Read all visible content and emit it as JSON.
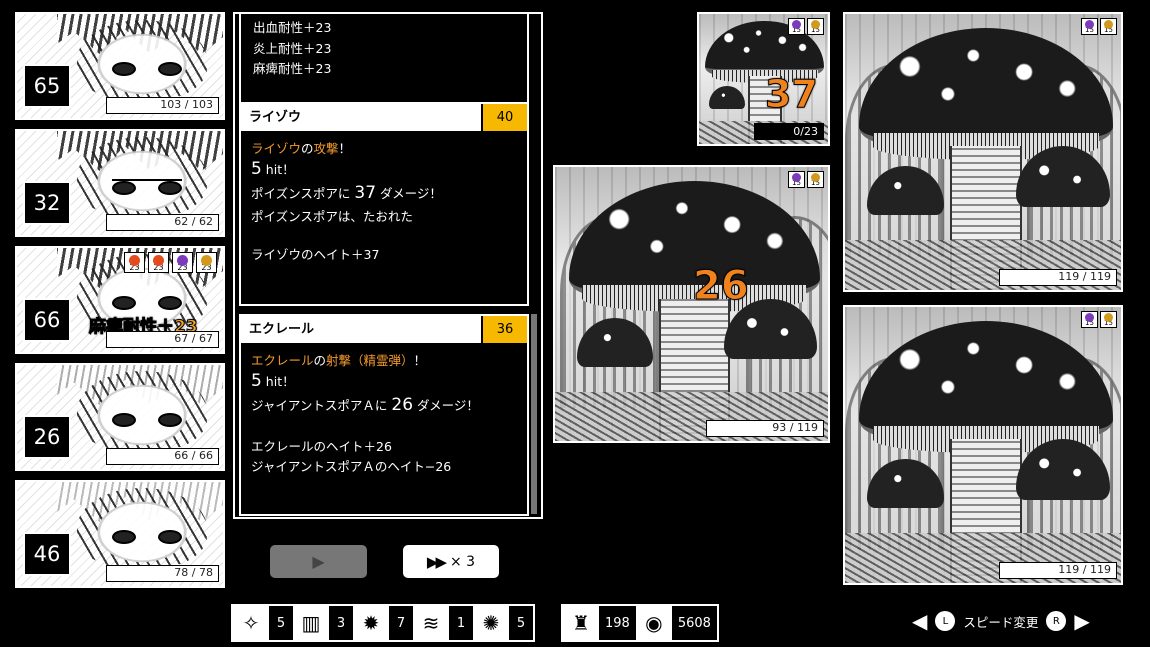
{
  "party": [
    {
      "level": "65",
      "hp": "103 / 103",
      "status": []
    },
    {
      "level": "32",
      "hp": "62 / 62",
      "status": []
    },
    {
      "level": "66",
      "hp": "67 / 67",
      "float": "麻痺耐性＋23",
      "status": [
        {
          "icon": "fire-icon",
          "value": "23",
          "color": "#e34b1f"
        },
        {
          "icon": "flame-icon",
          "value": "23",
          "color": "#e34b1f"
        },
        {
          "icon": "poison-icon",
          "value": "23",
          "color": "#7c3bbd"
        },
        {
          "icon": "shield-icon",
          "value": "23",
          "color": "#d29a1c"
        }
      ]
    },
    {
      "level": "26",
      "hp": "66 / 66",
      "status": []
    },
    {
      "level": "46",
      "hp": "78 / 78",
      "status": []
    }
  ],
  "log": {
    "top_lines": [
      "出血耐性＋23",
      "炎上耐性＋23",
      "麻痺耐性＋23"
    ],
    "entries": [
      {
        "name": "ライゾウ",
        "hate": "40",
        "actor": "ライゾウ",
        "action_pre": "の",
        "action": "攻撃",
        "action_post": "！",
        "hits": "5",
        "hit_suffix": " hit！",
        "damage_pre": "ポイズンスポアに",
        "damage": "37",
        "damage_post": "ダメージ！",
        "line4": "ポイズンスポアは、たおれた",
        "line5": "ライゾウのヘイト＋37",
        "line6": ""
      },
      {
        "name": "エクレール",
        "hate": "36",
        "actor": "エクレール",
        "action_pre": "の",
        "action": "射撃（精霊弾）",
        "action_post": "！",
        "hits": "5",
        "hit_suffix": " hit！",
        "damage_pre": "ジャイアントスポアＡに",
        "damage": "26",
        "damage_post": "ダメージ！",
        "line4": "",
        "line5": "エクレールのヘイト＋26",
        "line6": "ジャイアントスポアＡのヘイト−26"
      }
    ]
  },
  "controls": {
    "play_icon": "▶",
    "speed_arrows": "▶▶",
    "speed_mult": "× 3"
  },
  "enemies": [
    {
      "id": "poison-spore",
      "hp": "0/23",
      "damage": "37",
      "status": [
        {
          "icon": "poison-icon",
          "value": "15"
        },
        {
          "icon": "shield-icon",
          "value": "15"
        }
      ]
    },
    {
      "id": "giant-spore-a",
      "hp": "93 / 119",
      "damage": "26",
      "status": [
        {
          "icon": "poison-icon",
          "value": "15"
        },
        {
          "icon": "shield-icon",
          "value": "15"
        }
      ]
    },
    {
      "id": "giant-spore-b",
      "hp": "119 / 119",
      "status": [
        {
          "icon": "poison-icon",
          "value": "15"
        },
        {
          "icon": "shield-icon",
          "value": "15"
        }
      ]
    },
    {
      "id": "giant-spore-c",
      "hp": "119 / 119",
      "status": [
        {
          "icon": "poison-icon",
          "value": "15"
        },
        {
          "icon": "shield-icon",
          "value": "15"
        }
      ]
    }
  ],
  "inventory": {
    "items": [
      {
        "icon": "sparkle-icon",
        "glyph": "✧",
        "count": "5"
      },
      {
        "icon": "pillar-icon",
        "glyph": "▥",
        "count": "3"
      },
      {
        "icon": "burst-icon",
        "glyph": "✹",
        "count": "7"
      },
      {
        "icon": "wind-icon",
        "glyph": "≋",
        "count": "1"
      },
      {
        "icon": "bomb-icon",
        "glyph": "✺",
        "count": "5"
      }
    ],
    "resources": [
      {
        "icon": "potion-bag-icon",
        "glyph": "♜",
        "count": "198"
      },
      {
        "icon": "coin-bag-icon",
        "glyph": "◉",
        "count": "5608"
      }
    ]
  },
  "speed_hint": {
    "left_key": "L",
    "right_key": "R",
    "label": "スピード変更"
  },
  "colors": {
    "accent_orange": "#f39a2e",
    "hate_badge": "#f6b800",
    "damage_popup": "#f0821e"
  }
}
